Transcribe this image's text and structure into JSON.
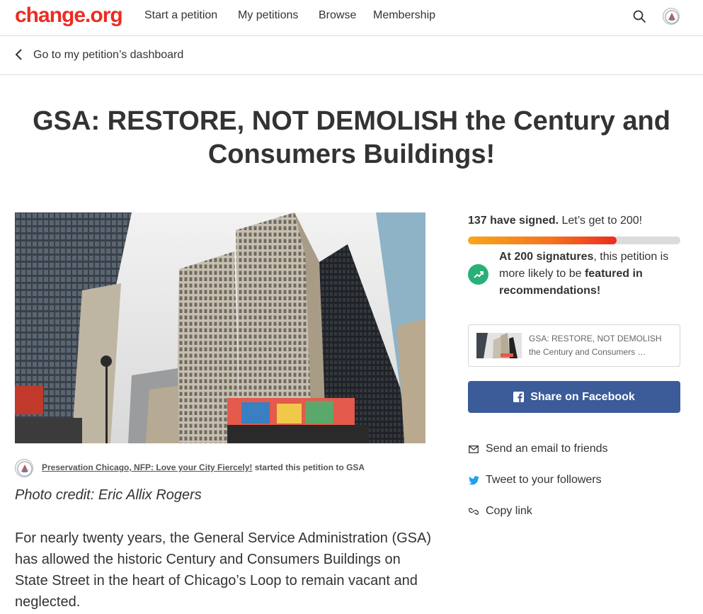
{
  "header": {
    "logo": "change.org",
    "nav": [
      "Start a petition",
      "My petitions",
      "Browse",
      "Membership"
    ]
  },
  "dashboard_link": "Go to my petition’s dashboard",
  "petition": {
    "title": "GSA: RESTORE, NOT DEMOLISH the Century and Consumers Buildings!",
    "starter": {
      "org": "Preservation Chicago, NFP: Love your City Fiercely!",
      "suffix": " started this petition to GSA"
    },
    "photo_credit": "Photo credit: Eric Allix Rogers",
    "body": "For nearly twenty years, the General Service Administration (GSA) has allowed the historic Century and Consumers Buildings on State Street in the heart of Chicago’s Loop to remain vacant and neglected."
  },
  "sidebar": {
    "signed_count": "137 have signed.",
    "signed_goal": " Let’s get to 200!",
    "progress": 0.7,
    "goal_bold": "At 200 signatures",
    "goal_text_1": ", this petition is more likely to be ",
    "goal_featured": "featured in recommendations!",
    "card_text": "GSA: RESTORE, NOT DEMOLISH the Century and Consumers …",
    "facebook_label": "Share on Facebook",
    "share_options": [
      {
        "icon": "email-icon",
        "label": "Send an email to friends"
      },
      {
        "icon": "twitter-icon",
        "label": "Tweet to your followers"
      },
      {
        "icon": "link-icon",
        "label": "Copy link"
      }
    ]
  },
  "colors": {
    "brand": "#ec2c22",
    "facebook": "#3b5b99",
    "success": "#28b077",
    "twitter": "#1da1f2"
  }
}
